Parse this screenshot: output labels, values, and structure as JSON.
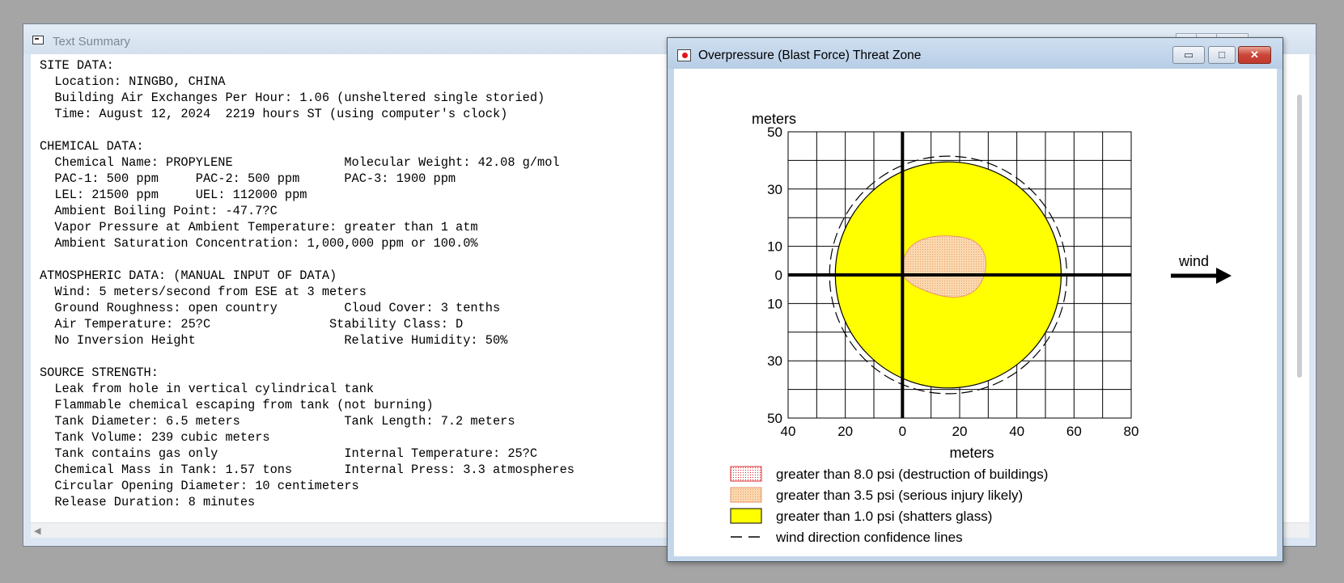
{
  "summary_window": {
    "title": "Text Summary",
    "lines": [
      "SITE DATA:",
      "  Location: NINGBO, CHINA",
      "  Building Air Exchanges Per Hour: 1.06 (unsheltered single storied)",
      "  Time: August 12, 2024  2219 hours ST (using computer's clock)",
      "",
      "CHEMICAL DATA:",
      "  Chemical Name: PROPYLENE               Molecular Weight: 42.08 g/mol",
      "  PAC-1: 500 ppm     PAC-2: 500 ppm      PAC-3: 1900 ppm",
      "  LEL: 21500 ppm     UEL: 112000 ppm",
      "  Ambient Boiling Point: -47.7?C",
      "  Vapor Pressure at Ambient Temperature: greater than 1 atm",
      "  Ambient Saturation Concentration: 1,000,000 ppm or 100.0%",
      "",
      "ATMOSPHERIC DATA: (MANUAL INPUT OF DATA)",
      "  Wind: 5 meters/second from ESE at 3 meters",
      "  Ground Roughness: open country         Cloud Cover: 3 tenths",
      "  Air Temperature: 25?C                Stability Class: D",
      "  No Inversion Height                    Relative Humidity: 50%",
      "",
      "SOURCE STRENGTH:",
      "  Leak from hole in vertical cylindrical tank",
      "  Flammable chemical escaping from tank (not burning)",
      "  Tank Diameter: 6.5 meters              Tank Length: 7.2 meters",
      "  Tank Volume: 239 cubic meters",
      "  Tank contains gas only                 Internal Temperature: 25?C",
      "  Chemical Mass in Tank: 1.57 tons       Internal Press: 3.3 atmospheres",
      "  Circular Opening Diameter: 10 centimeters",
      "  Release Duration: 8 minutes"
    ]
  },
  "threat_window": {
    "title": "Overpressure (Blast Force) Threat Zone",
    "buttons": {
      "minimize": "▭",
      "maximize": "□",
      "close": "✕"
    },
    "wind_label": "wind"
  },
  "chart_data": {
    "type": "threat-zone-map",
    "ylabel": "meters",
    "xlabel": "meters",
    "xlim": [
      -40,
      80
    ],
    "ylim": [
      -50,
      50
    ],
    "x_ticks": [
      -40,
      -20,
      0,
      20,
      40,
      60,
      80
    ],
    "x_tick_labels": [
      "40",
      "20",
      "0",
      "20",
      "40",
      "60",
      "80"
    ],
    "y_ticks": [
      50,
      30,
      10,
      0,
      -10,
      -30,
      -50
    ],
    "y_tick_labels": [
      "50",
      "30",
      "10",
      "0",
      "10",
      "30",
      "50"
    ],
    "grid": true,
    "zones": [
      {
        "name": "greater than 1.0 psi (shatters glass)",
        "color": "#ffff00",
        "center": [
          16,
          0
        ],
        "radius": 39.5
      },
      {
        "name": "greater than 3.5 psi (serious injury likely)",
        "color": "#fbd9b0",
        "center": [
          15,
          3
        ],
        "rx": 15,
        "ry": 10
      }
    ],
    "confidence_lines": {
      "center": [
        16,
        0
      ],
      "radius": 41.5
    },
    "legend": [
      {
        "label": "greater than 8.0 psi (destruction of buildings)",
        "swatch": "red-dotted"
      },
      {
        "label": "greater than 3.5 psi (serious injury likely)",
        "swatch": "#fbd9b0"
      },
      {
        "label": "greater than 1.0 psi (shatters glass)",
        "swatch": "#ffff00"
      },
      {
        "label": "wind direction confidence lines",
        "swatch": "dashed-line"
      }
    ]
  }
}
